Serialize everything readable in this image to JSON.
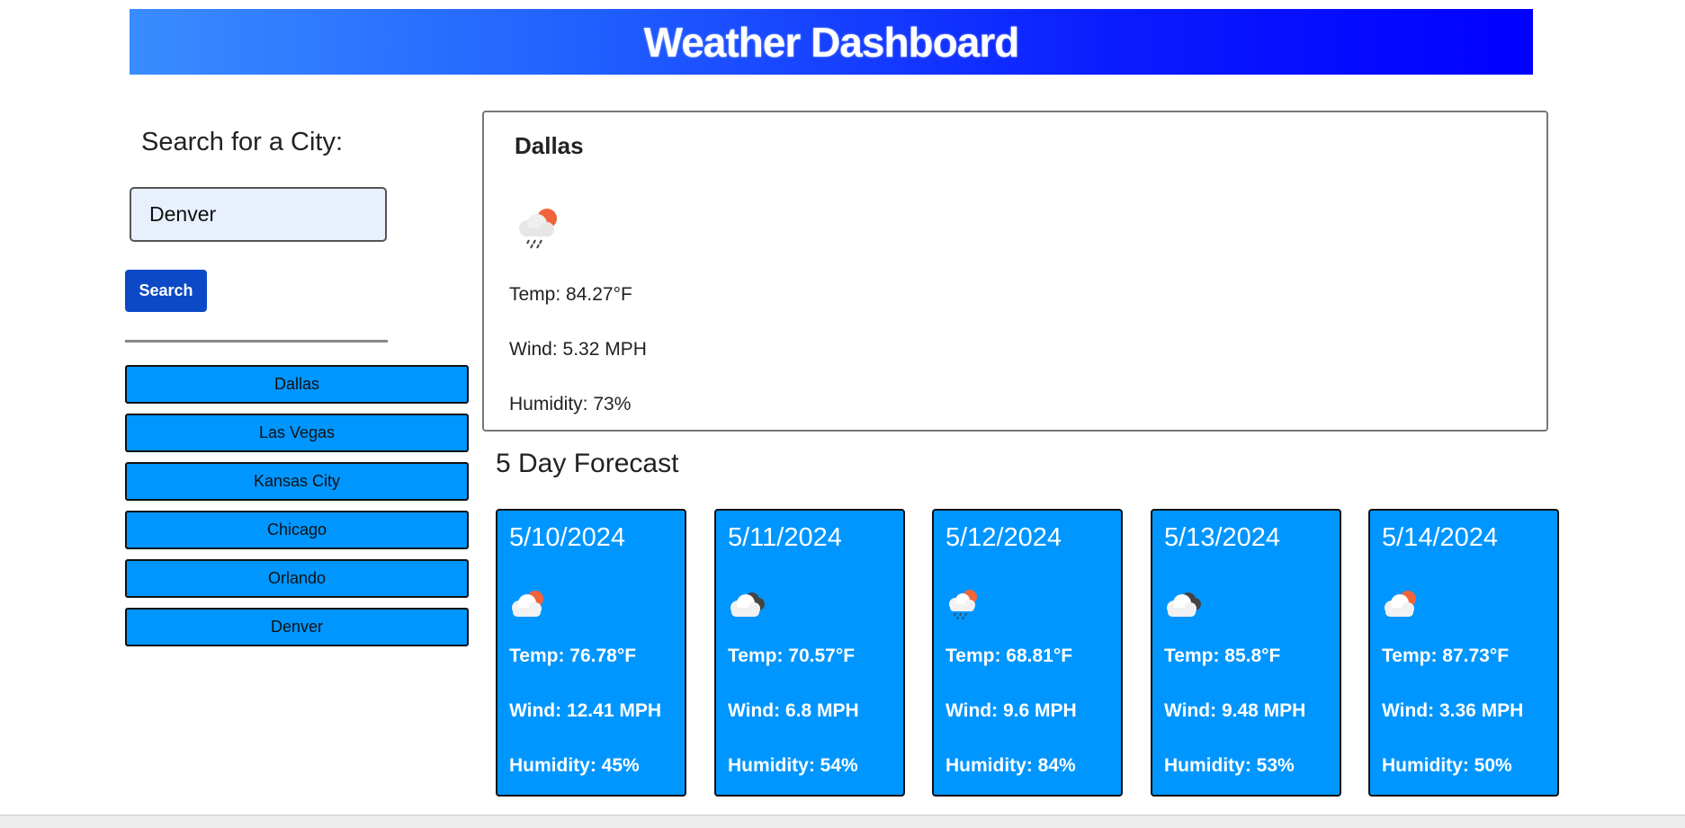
{
  "header": {
    "title": "Weather Dashboard"
  },
  "search": {
    "label": "Search for a City:",
    "input_value": "Denver",
    "button_label": "Search"
  },
  "history": [
    "Dallas",
    "Las Vegas",
    "Kansas City",
    "Chicago",
    "Orlando",
    "Denver"
  ],
  "current": {
    "city": "Dallas",
    "icon": "rain-sun-icon",
    "temp": "Temp: 84.27°F",
    "wind": "Wind: 5.32 MPH",
    "humidity": "Humidity: 73%"
  },
  "forecast": {
    "title": "5 Day Forecast",
    "days": [
      {
        "date": "5/10/2024",
        "icon": "partly-cloudy-icon",
        "temp": "Temp: 76.78°F",
        "wind": "Wind: 12.41 MPH",
        "humidity": "Humidity: 45%"
      },
      {
        "date": "5/11/2024",
        "icon": "broken-clouds-icon",
        "temp": "Temp: 70.57°F",
        "wind": "Wind: 6.8 MPH",
        "humidity": "Humidity: 54%"
      },
      {
        "date": "5/12/2024",
        "icon": "rain-sun-icon",
        "temp": "Temp: 68.81°F",
        "wind": "Wind: 9.6 MPH",
        "humidity": "Humidity: 84%"
      },
      {
        "date": "5/13/2024",
        "icon": "broken-clouds-icon",
        "temp": "Temp: 85.8°F",
        "wind": "Wind: 9.48 MPH",
        "humidity": "Humidity: 53%"
      },
      {
        "date": "5/14/2024",
        "icon": "partly-cloudy-icon",
        "temp": "Temp: 87.73°F",
        "wind": "Wind: 3.36 MPH",
        "humidity": "Humidity: 50%"
      }
    ]
  },
  "colors": {
    "header_start": "#3a8cff",
    "header_end": "#0000ff",
    "accent": "#0096ff",
    "search_button": "#0b49c7",
    "input_bg": "#e8f0fe",
    "sun": "#f0643c",
    "dark_cloud": "#444444"
  }
}
